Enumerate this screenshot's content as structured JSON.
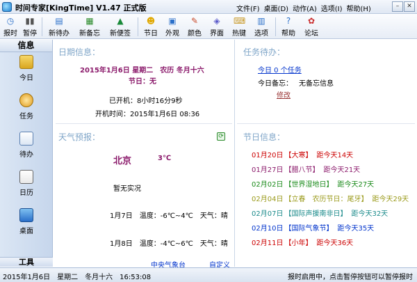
{
  "titlebar": {
    "title": "时间专家[KingTime] V1.47 正式版",
    "menu": [
      "文件(F)",
      "桌面(D)",
      "动作(A)",
      "选项(I)",
      "帮助(H)"
    ]
  },
  "toolbar": {
    "buttons": [
      "报时",
      "暂停",
      "新待办",
      "新备忘",
      "新便签",
      "节日",
      "外观",
      "颜色",
      "界面",
      "热键",
      "选项",
      "帮助",
      "论坛"
    ]
  },
  "sidebar": {
    "header": "信息",
    "items": [
      "今日",
      "任务",
      "待办",
      "日历",
      "桌面"
    ],
    "footer": "工具"
  },
  "date_info": {
    "title": "日期信息：",
    "date_line": "2015年1月6日 星期二　农历 冬月十六",
    "festival_line": "节日：无",
    "uptime": "已开机：8小时16分9秒",
    "boot_time": "开机时间：2015年1月6日 08:36"
  },
  "weather": {
    "title": "天气预报：",
    "city": "北京",
    "temp": "3℃",
    "live": "暂无实况",
    "forecast": [
      "1月7日　温度：-6℃~4℃　天气：晴",
      "1月8日　温度：-4℃~6℃　天气：晴"
    ],
    "link_source": "中央气象台",
    "link_custom": "自定义"
  },
  "tasks": {
    "title": "任务待办：",
    "today_link": "今日 0 个任务",
    "memo_label": "今日备忘：",
    "memo_value": "无备忘信息",
    "edit_link": "修改"
  },
  "festivals": {
    "title": "节日信息：",
    "rows": [
      {
        "date": "01月20日",
        "name": "【大寒】",
        "days": "距今天14天",
        "color": "#cc0000"
      },
      {
        "date": "01月27日",
        "name": "【腊八节】",
        "days": "距今天21天",
        "color": "#8b1a6b"
      },
      {
        "date": "02月02日",
        "name": "【世界湿地日】",
        "days": "距今天27天",
        "color": "#1a8a1a"
      },
      {
        "date": "02月04日",
        "name": "【立春　农历节日：尾牙】",
        "days": "距今天29天",
        "color": "#9a9a1a"
      },
      {
        "date": "02月07日",
        "name": "【国际声援南非日】",
        "days": "距今天32天",
        "color": "#1a8a8a"
      },
      {
        "date": "02月10日",
        "name": "【国际气象节】",
        "days": "距今天35天",
        "color": "#0033cc"
      },
      {
        "date": "02月11日",
        "name": "【小年】",
        "days": "距今天36天",
        "color": "#cc0000"
      }
    ]
  },
  "status": {
    "left": "2015年1月6日　星期二　冬月十六　16:53:08",
    "right": "报时启用中，点击暂停按钮可以暂停报时"
  }
}
